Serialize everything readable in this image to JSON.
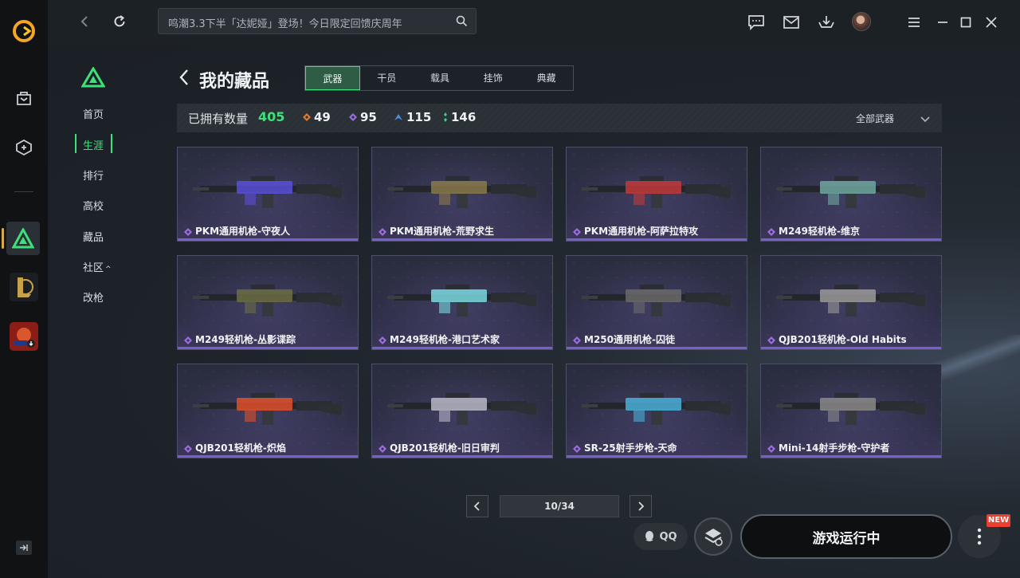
{
  "topbar": {
    "search_placeholder": "鸣潮3.3下半「达妮娅」登场！今日限定回馈庆周年"
  },
  "subnav": {
    "items": [
      {
        "label": "首页"
      },
      {
        "label": "生涯",
        "active": true
      },
      {
        "label": "排行"
      },
      {
        "label": "高校"
      },
      {
        "label": "藏品"
      },
      {
        "label": "社区"
      },
      {
        "label": "改枪"
      }
    ]
  },
  "page": {
    "title": "我的藏品",
    "tabs": [
      "武器",
      "干员",
      "载具",
      "挂饰",
      "典藏"
    ],
    "active_tab": "武器"
  },
  "stats": {
    "owned_label": "已拥有数量",
    "owned_total": "405",
    "tiers": [
      {
        "value": "49",
        "color": "#e07a2c"
      },
      {
        "value": "95",
        "color": "#9b6de0"
      },
      {
        "value": "115",
        "color": "#4a8fe0"
      },
      {
        "value": "146",
        "color": "#3ccf8e"
      }
    ],
    "filter_label": "全部武器"
  },
  "items": [
    {
      "name": "PKM通用机枪-守夜人",
      "accent": "#5b4fd8"
    },
    {
      "name": "PKM通用机枪-荒野求生",
      "accent": "#8a7a4a"
    },
    {
      "name": "PKM通用机枪-阿萨拉特攻",
      "accent": "#c23a3a"
    },
    {
      "name": "M249轻机枪-维京",
      "accent": "#6fa8a0"
    },
    {
      "name": "M249轻机枪-丛影谍踪",
      "accent": "#6b6d44"
    },
    {
      "name": "M249轻机枪-港口艺术家",
      "accent": "#7ad9e0"
    },
    {
      "name": "M250通用机枪-囚徒",
      "accent": "#6a6a6a"
    },
    {
      "name": "QJB201轻机枪-Old Habits",
      "accent": "#9a9a9a"
    },
    {
      "name": "QJB201轻机枪-炽焰",
      "accent": "#e0502a"
    },
    {
      "name": "QJB201轻机枪-旧日审判",
      "accent": "#b8b8c8"
    },
    {
      "name": "SR-25射手步枪-天命",
      "accent": "#4ab0d8"
    },
    {
      "name": "Mini-14射手步枪-守护者",
      "accent": "#8a8a8a"
    }
  ],
  "pagination": {
    "label": "10/34"
  },
  "bottom": {
    "qq_label": "QQ",
    "launch_label": "游戏运行中",
    "new_badge": "NEW"
  }
}
